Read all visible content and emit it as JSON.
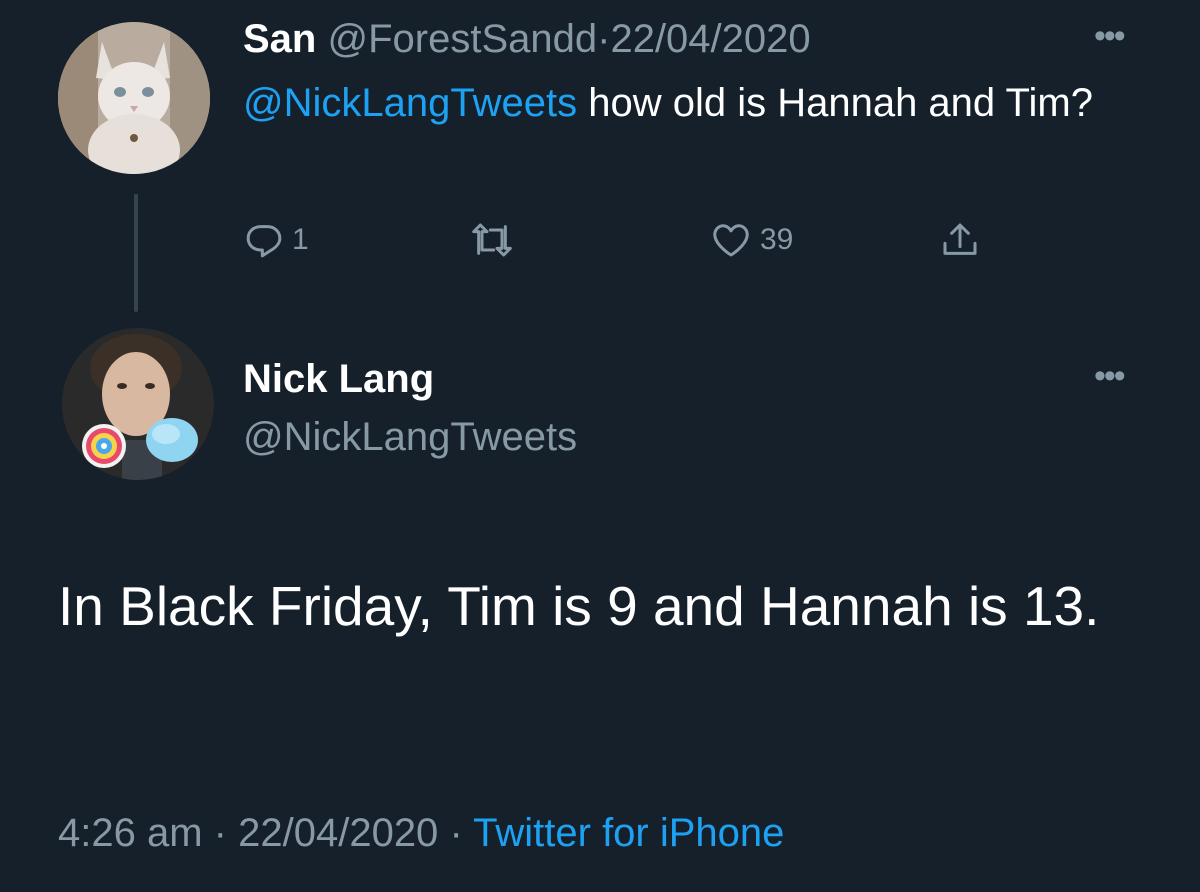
{
  "reply_tweet": {
    "display_name": "San",
    "handle": "@ForestSandd",
    "separator": "·",
    "date": "22/04/2020",
    "mention": "@NickLangTweets",
    "text": " how old is Hannah and Tim?",
    "reply_count": "1",
    "like_count": "39",
    "more_label": "•••"
  },
  "main_tweet": {
    "display_name": "Nick Lang",
    "handle": "@NickLangTweets",
    "text": "In Black Friday, Tim is 9 and Hannah is 13.",
    "time": "4:26 am",
    "separator": "·",
    "date": "22/04/2020",
    "source": "Twitter for iPhone",
    "more_label": "•••"
  },
  "colors": {
    "background": "#15202b",
    "text": "#ffffff",
    "muted": "#8899a6",
    "link": "#1da1f2",
    "thread_line": "#38444d"
  },
  "icons": {
    "reply": "speech-bubble-icon",
    "retweet": "retweet-arrows-icon",
    "like": "heart-icon",
    "share": "share-upload-icon",
    "more": "more-dots-icon"
  }
}
